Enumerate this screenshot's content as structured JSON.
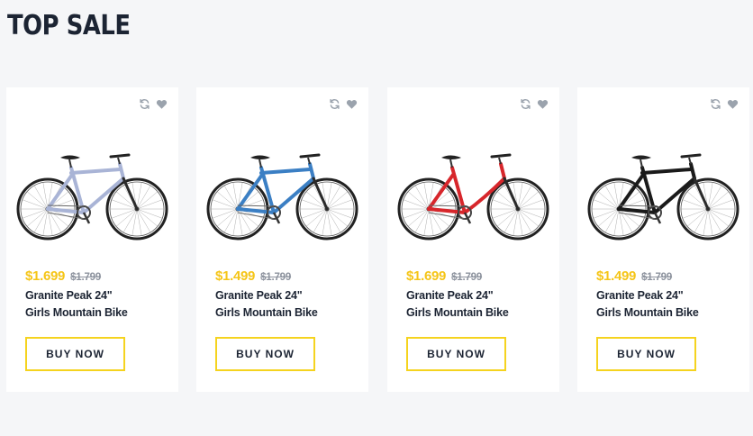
{
  "section": {
    "title": "TOP SALE"
  },
  "colors": {
    "accent_yellow": "#f5c518",
    "button_border": "#f5d31f",
    "text_dark": "#1c2433",
    "text_muted": "#8d939e",
    "icon_gray": "#9ba3ad"
  },
  "products": [
    {
      "price": "$1.699",
      "old_price": "$1.799",
      "name_line1": "Granite Peak 24\"",
      "name_line2": "Girls Mountain Bike",
      "button_label": "BUY NOW",
      "bike_color": "#a9b4d6",
      "icons": [
        "refresh-icon",
        "heart-icon"
      ]
    },
    {
      "price": "$1.499",
      "old_price": "$1.799",
      "name_line1": "Granite Peak 24\"",
      "name_line2": "Girls Mountain Bike",
      "button_label": "BUY NOW",
      "bike_color": "#3b7fc4",
      "icons": [
        "refresh-icon",
        "heart-icon"
      ]
    },
    {
      "price": "$1.699",
      "old_price": "$1.799",
      "name_line1": "Granite Peak 24\"",
      "name_line2": "Girls Mountain Bike",
      "button_label": "BUY NOW",
      "bike_color": "#d7262b",
      "icons": [
        "refresh-icon",
        "heart-icon"
      ]
    },
    {
      "price": "$1.499",
      "old_price": "$1.799",
      "name_line1": "Granite Peak 24\"",
      "name_line2": "Girls Mountain Bike",
      "button_label": "BUY NOW",
      "bike_color": "#1a1a1a",
      "icons": [
        "refresh-icon",
        "heart-icon"
      ]
    }
  ]
}
